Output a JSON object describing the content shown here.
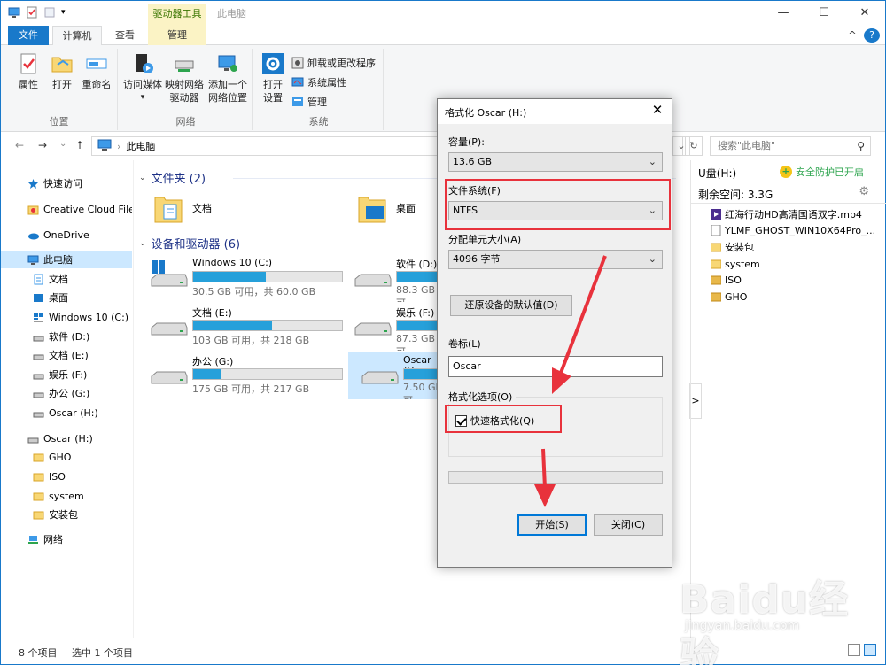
{
  "titlebar": {
    "context_group": "驱动器工具",
    "title": "此电脑",
    "minimize": "—",
    "maximize": "☐",
    "close": "✕"
  },
  "tabs": {
    "file": "文件",
    "computer": "计算机",
    "view": "查看",
    "manage": "管理",
    "collapse": "^",
    "help": "?"
  },
  "ribbon": {
    "groups": {
      "location": "位置",
      "network": "网络",
      "system": "系统"
    },
    "buttons": {
      "properties": "属性",
      "open": "打开",
      "rename": "重命名",
      "access_media_1": "访问媒体",
      "map_drive_1": "映射网络",
      "map_drive_2": "驱动器",
      "add_location_1": "添加一个",
      "add_location_2": "网络位置",
      "open_settings_1": "打开",
      "open_settings_2": "设置",
      "uninstall": "卸载或更改程序",
      "system_props": "系统属性",
      "manage": "管理"
    }
  },
  "nav": {
    "back": "←",
    "forward": "→",
    "dropdown": "⌄",
    "up": "↑",
    "path": "此电脑",
    "refresh": "↻",
    "search_placeholder": "搜索\"此电脑\"",
    "search_icon": "⚲"
  },
  "sidebar": {
    "items": [
      {
        "label": "快速访问",
        "icon": "star-icon"
      },
      {
        "label": "Creative Cloud Files",
        "icon": "cloud-folder-icon"
      },
      {
        "label": "OneDrive",
        "icon": "onedrive-icon"
      },
      {
        "label": "此电脑",
        "icon": "computer-icon"
      },
      {
        "label": "文档",
        "icon": "documents-icon"
      },
      {
        "label": "桌面",
        "icon": "desktop-icon"
      },
      {
        "label": "Windows 10 (C:)",
        "icon": "windows-drive-icon"
      },
      {
        "label": "软件 (D:)",
        "icon": "drive-icon"
      },
      {
        "label": "文档 (E:)",
        "icon": "drive-icon"
      },
      {
        "label": "娱乐 (F:)",
        "icon": "drive-icon"
      },
      {
        "label": "办公 (G:)",
        "icon": "drive-icon"
      },
      {
        "label": "Oscar (H:)",
        "icon": "drive-icon"
      },
      {
        "label": "Oscar (H:)",
        "icon": "drive-icon"
      },
      {
        "label": "GHO",
        "icon": "folder-icon"
      },
      {
        "label": "ISO",
        "icon": "folder-icon"
      },
      {
        "label": "system",
        "icon": "folder-icon"
      },
      {
        "label": "安装包",
        "icon": "folder-icon"
      },
      {
        "label": "网络",
        "icon": "network-icon"
      }
    ]
  },
  "main": {
    "folders_header": "文件夹 (2)",
    "drives_header": "设备和驱动器 (6)",
    "folders": [
      {
        "name": "文档"
      },
      {
        "name": "桌面"
      }
    ],
    "drives": [
      {
        "name": "Windows 10 (C:)",
        "info": "30.5 GB 可用，共 60.0 GB",
        "used_fraction": 0.49
      },
      {
        "name": "软件 (D:)",
        "info": "88.3 GB 可",
        "used_fraction": 0.5
      },
      {
        "name": "文档 (E:)",
        "info": "103 GB 可用，共 218 GB",
        "used_fraction": 0.53
      },
      {
        "name": "娱乐 (F:)",
        "info": "87.3 GB 可",
        "used_fraction": 0.5
      },
      {
        "name": "办公 (G:)",
        "info": "175 GB 可用，共 217 GB",
        "used_fraction": 0.19
      },
      {
        "name": "Oscar (H:",
        "info": "7.50 GB 可",
        "used_fraction": 0.45
      }
    ]
  },
  "preview": {
    "title": "U盘(H:)",
    "safe": "安全防护已开启",
    "free": "剩余空间: 3.3G",
    "files": [
      {
        "name": "红海行动HD高清国语双字.mp4",
        "icon": "video-file-icon"
      },
      {
        "name": "YLMF_GHOST_WIN10X64Pro_...",
        "icon": "file-icon"
      },
      {
        "name": "安装包",
        "icon": "folder-icon"
      },
      {
        "name": "system",
        "icon": "folder-icon"
      },
      {
        "name": "ISO",
        "icon": "folder-icon"
      },
      {
        "name": "GHO",
        "icon": "folder-icon"
      }
    ],
    "splitter": ">"
  },
  "statusbar": {
    "count": "8 个项目",
    "selected": "选中 1 个项目"
  },
  "dialog": {
    "title": "格式化 Oscar (H:)",
    "close": "✕",
    "capacity_label": "容量(P):",
    "capacity_value": "13.6 GB",
    "fs_label": "文件系统(F)",
    "fs_value": "NTFS",
    "alloc_label": "分配单元大小(A)",
    "alloc_value": "4096 字节",
    "restore_button": "还原设备的默认值(D)",
    "volume_label": "卷标(L)",
    "volume_value": "Oscar",
    "options_label": "格式化选项(O)",
    "quick_format": "快速格式化(Q)",
    "quick_format_checked": true,
    "start_button": "开始(S)",
    "close_button": "关闭(C)"
  },
  "watermark": {
    "main": "Baidu经验",
    "sub": "jingyan.baidu.com"
  },
  "colors": {
    "accent": "#1979ca",
    "annotation": "#e8323c",
    "drive_fill": "#26a0da",
    "selection": "#cce8ff"
  }
}
